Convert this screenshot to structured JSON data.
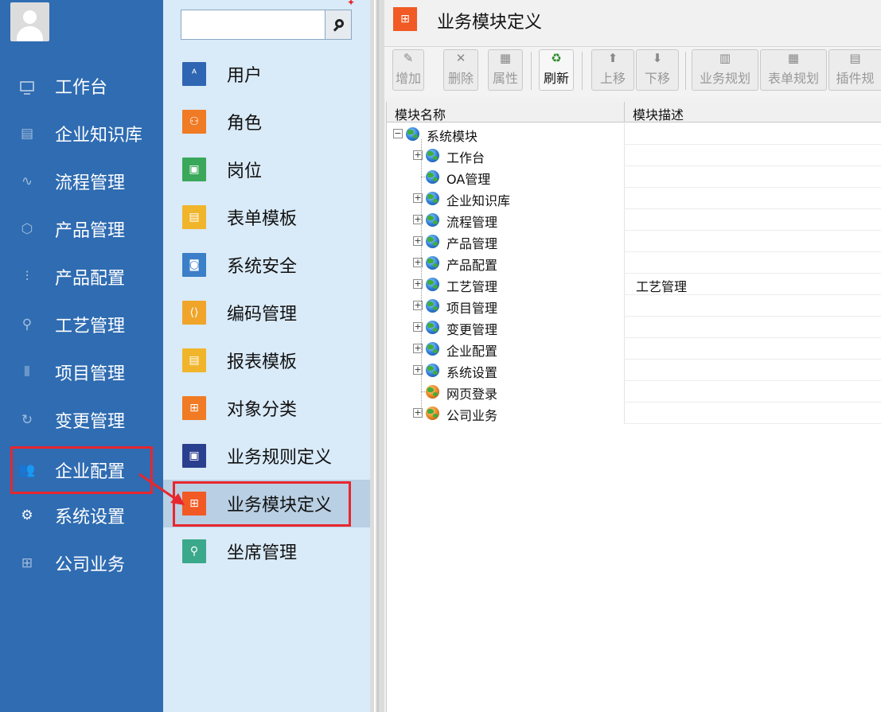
{
  "nav": {
    "items": [
      {
        "label": "工作台",
        "icon": "monitor-icon"
      },
      {
        "label": "企业知识库",
        "icon": "book-icon"
      },
      {
        "label": "流程管理",
        "icon": "flow-icon"
      },
      {
        "label": "产品管理",
        "icon": "cube-icon"
      },
      {
        "label": "产品配置",
        "icon": "sliders-icon"
      },
      {
        "label": "工艺管理",
        "icon": "wrench-icon"
      },
      {
        "label": "项目管理",
        "icon": "project-icon"
      },
      {
        "label": "变更管理",
        "icon": "change-icon"
      },
      {
        "label": "企业配置",
        "icon": "users-icon",
        "active": true
      },
      {
        "label": "系统设置",
        "icon": "gear-icon"
      },
      {
        "label": "公司业务",
        "icon": "grid-icon"
      }
    ]
  },
  "search": {
    "placeholder": "",
    "value": ""
  },
  "submenu": {
    "items": [
      {
        "label": "用户",
        "color": "#2f66b3",
        "icon": "user-icon"
      },
      {
        "label": "角色",
        "color": "#f07b24",
        "icon": "role-icon"
      },
      {
        "label": "岗位",
        "color": "#3aa85a",
        "icon": "post-icon"
      },
      {
        "label": "表单模板",
        "color": "#f1b52b",
        "icon": "form-icon"
      },
      {
        "label": "系统安全",
        "color": "#3a7fc7",
        "icon": "security-icon"
      },
      {
        "label": "编码管理",
        "color": "#f0a52a",
        "icon": "code-icon"
      },
      {
        "label": "报表模板",
        "color": "#f1b52b",
        "icon": "report-icon"
      },
      {
        "label": "对象分类",
        "color": "#f07b24",
        "icon": "category-icon"
      },
      {
        "label": "业务规则定义",
        "color": "#2b3f8f",
        "icon": "rule-icon"
      },
      {
        "label": "业务模块定义",
        "color": "#f15a24",
        "icon": "module-icon",
        "selected": true
      },
      {
        "label": "坐席管理",
        "color": "#3aa88a",
        "icon": "seat-icon"
      }
    ]
  },
  "page": {
    "title": "业务模块定义"
  },
  "toolbar": {
    "buttons": [
      {
        "label": "增加",
        "enabled": false
      },
      {
        "label": "删除",
        "enabled": false
      },
      {
        "label": "属性",
        "enabled": false
      },
      {
        "label": "刷新",
        "enabled": true
      },
      {
        "label": "上移",
        "enabled": false
      },
      {
        "label": "下移",
        "enabled": false
      },
      {
        "label": "业务规划",
        "enabled": false
      },
      {
        "label": "表单规划",
        "enabled": false
      },
      {
        "label": "插件规",
        "enabled": false
      }
    ]
  },
  "grid": {
    "columns": [
      "模块名称",
      "模块描述"
    ],
    "rows": [
      {
        "name": "系统模块",
        "desc": "",
        "level": 0,
        "expander": "minus",
        "icon": "globe"
      },
      {
        "name": "工作台",
        "desc": "",
        "level": 1,
        "expander": "plus",
        "icon": "globe"
      },
      {
        "name": "OA管理",
        "desc": "",
        "level": 1,
        "expander": "none",
        "icon": "globe"
      },
      {
        "name": "企业知识库",
        "desc": "",
        "level": 1,
        "expander": "plus",
        "icon": "globe"
      },
      {
        "name": "流程管理",
        "desc": "",
        "level": 1,
        "expander": "plus",
        "icon": "globe"
      },
      {
        "name": "产品管理",
        "desc": "",
        "level": 1,
        "expander": "plus",
        "icon": "globe"
      },
      {
        "name": "产品配置",
        "desc": "",
        "level": 1,
        "expander": "plus",
        "icon": "globe"
      },
      {
        "name": "工艺管理",
        "desc": "工艺管理",
        "level": 1,
        "expander": "plus",
        "icon": "globe"
      },
      {
        "name": "项目管理",
        "desc": "",
        "level": 1,
        "expander": "plus",
        "icon": "globe"
      },
      {
        "name": "变更管理",
        "desc": "",
        "level": 1,
        "expander": "plus",
        "icon": "globe"
      },
      {
        "name": "企业配置",
        "desc": "",
        "level": 1,
        "expander": "plus",
        "icon": "globe"
      },
      {
        "name": "系统设置",
        "desc": "",
        "level": 1,
        "expander": "plus",
        "icon": "globe"
      },
      {
        "name": "网页登录",
        "desc": "",
        "level": 1,
        "expander": "none",
        "icon": "web"
      },
      {
        "name": "公司业务",
        "desc": "",
        "level": 1,
        "expander": "plus",
        "icon": "web"
      }
    ]
  },
  "colors": {
    "nav_bg": "#2f6cb2",
    "submenu_bg": "#d9eaf8",
    "highlight": "#e8262d"
  }
}
